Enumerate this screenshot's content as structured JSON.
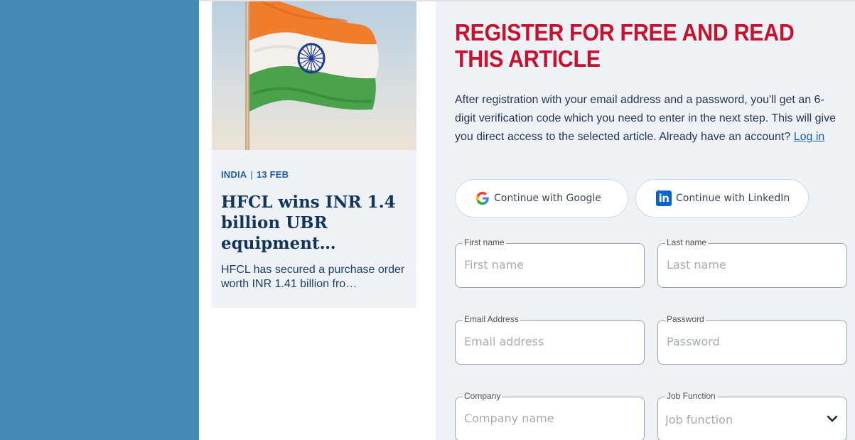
{
  "article": {
    "category": "INDIA",
    "date": "13 FEB",
    "separator": "|",
    "title": "HFCL wins INR 1.4 billion UBR equipment…",
    "excerpt": "HFCL has secured a purchase order worth INR 1.41 billion fro…"
  },
  "register": {
    "heading": "REGISTER FOR FREE AND READ THIS ARTICLE",
    "intro": "After registration with your email address and a password, you'll get an 6-digit verification code which you need to enter in the next step. This will give you direct access to the selected article. Already have an account?",
    "login_link": "Log in",
    "google_button": "Continue with Google",
    "linkedin_button": "Continue with LinkedIn",
    "linkedin_icon_text": "in",
    "fields": {
      "first_name": {
        "label": "First name",
        "placeholder": "First name"
      },
      "last_name": {
        "label": "Last name",
        "placeholder": "Last name"
      },
      "email": {
        "label": "Email Address",
        "placeholder": "Email address"
      },
      "password": {
        "label": "Password",
        "placeholder": "Password"
      },
      "company": {
        "label": "Company",
        "placeholder": "Company name"
      },
      "job_function": {
        "label": "Job Function",
        "placeholder": "Job function"
      }
    }
  },
  "colors": {
    "sidebar_band": "#4589b5",
    "heading_red": "#c4122f",
    "link_blue": "#1d5fa6",
    "article_title": "#12355b",
    "linkedin_blue": "#0a66c2"
  },
  "icons": {
    "image": "india-flag-photo",
    "google": "google-icon",
    "linkedin": "linkedin-icon",
    "select": "chevron-down-icon"
  }
}
